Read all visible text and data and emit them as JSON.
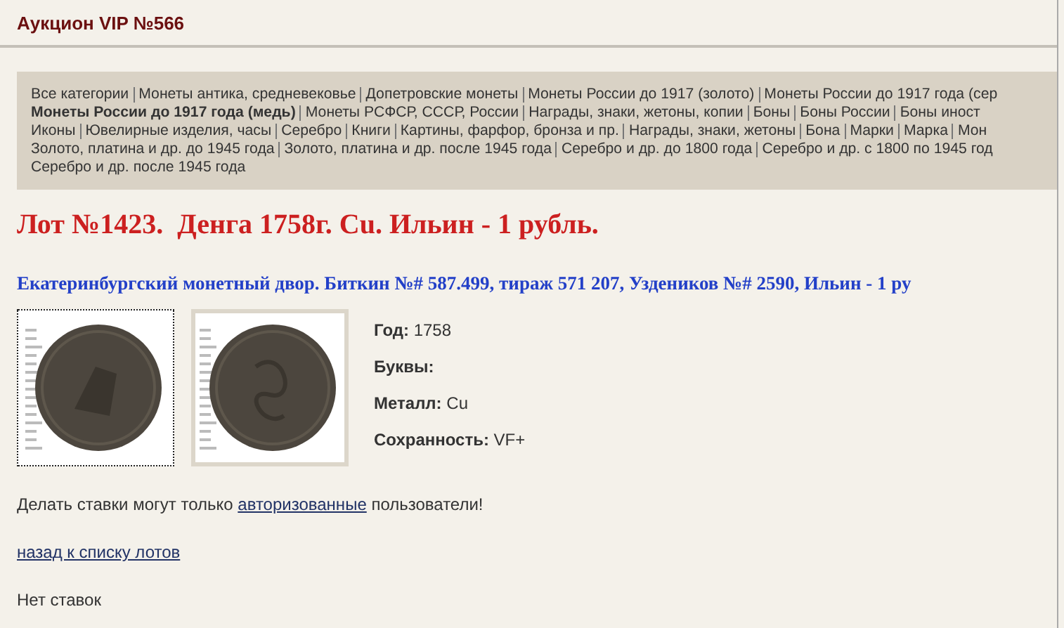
{
  "header": {
    "title": "Аукцион VIP №566"
  },
  "categories": {
    "lines": [
      [
        {
          "label": "Все категории",
          "selected": false
        },
        {
          "label": "Монеты антика, средневековье",
          "selected": false
        },
        {
          "label": "Допетровские монеты",
          "selected": false
        },
        {
          "label": "Монеты России до 1917 (золото)",
          "selected": false
        },
        {
          "label": "Монеты России до 1917 года (сер",
          "selected": false
        }
      ],
      [
        {
          "label": "Монеты России до 1917 года (медь)",
          "selected": true
        },
        {
          "label": "Монеты РСФСР, СССР, России",
          "selected": false
        },
        {
          "label": "Награды, знаки, жетоны, копии",
          "selected": false
        },
        {
          "label": "Боны",
          "selected": false
        },
        {
          "label": "Боны России",
          "selected": false
        },
        {
          "label": "Боны иност",
          "selected": false
        }
      ],
      [
        {
          "label": "Иконы",
          "selected": false
        },
        {
          "label": "Ювелирные изделия, часы",
          "selected": false
        },
        {
          "label": "Серебро",
          "selected": false
        },
        {
          "label": "Книги",
          "selected": false
        },
        {
          "label": "Картины, фарфор, бронза и пр.",
          "selected": false
        },
        {
          "label": "Награды, знаки, жетоны",
          "selected": false
        },
        {
          "label": "Бона",
          "selected": false
        },
        {
          "label": "Марки",
          "selected": false
        },
        {
          "label": "Марка",
          "selected": false
        },
        {
          "label": "Мон",
          "selected": false
        }
      ],
      [
        {
          "label": "Золото, платина и др. до 1945 года",
          "selected": false
        },
        {
          "label": "Золото, платина и др. после 1945 года",
          "selected": false
        },
        {
          "label": "Серебро и др. до 1800 года",
          "selected": false
        },
        {
          "label": "Серебро и др. с 1800 по 1945 год",
          "selected": false
        }
      ],
      [
        {
          "label": "Серебро и др. после 1945 года",
          "selected": false
        }
      ]
    ]
  },
  "lot": {
    "title": "Лот №1423.  Денга 1758г. Cu. Ильин - 1 рубль.",
    "subtitle": "Екатеринбургский монетный двор. Биткин №# 587.499, тираж 571 207, Уздеников №# 2590, Ильин - 1 ру"
  },
  "photos": [
    {
      "selected": true
    },
    {
      "selected": false
    }
  ],
  "specs": [
    {
      "label": "Год:",
      "value": "1758"
    },
    {
      "label": "Буквы:"
    },
    {
      "label": "Металл:",
      "value": "Cu"
    },
    {
      "label": "Сохранность:",
      "value": "VF+"
    }
  ],
  "notice": {
    "before": "Делать ставки могут только",
    "link": "авторизованные",
    "after": "пользователи!"
  },
  "back_link": "назад к списку лотов",
  "bids": "Нет ставок"
}
